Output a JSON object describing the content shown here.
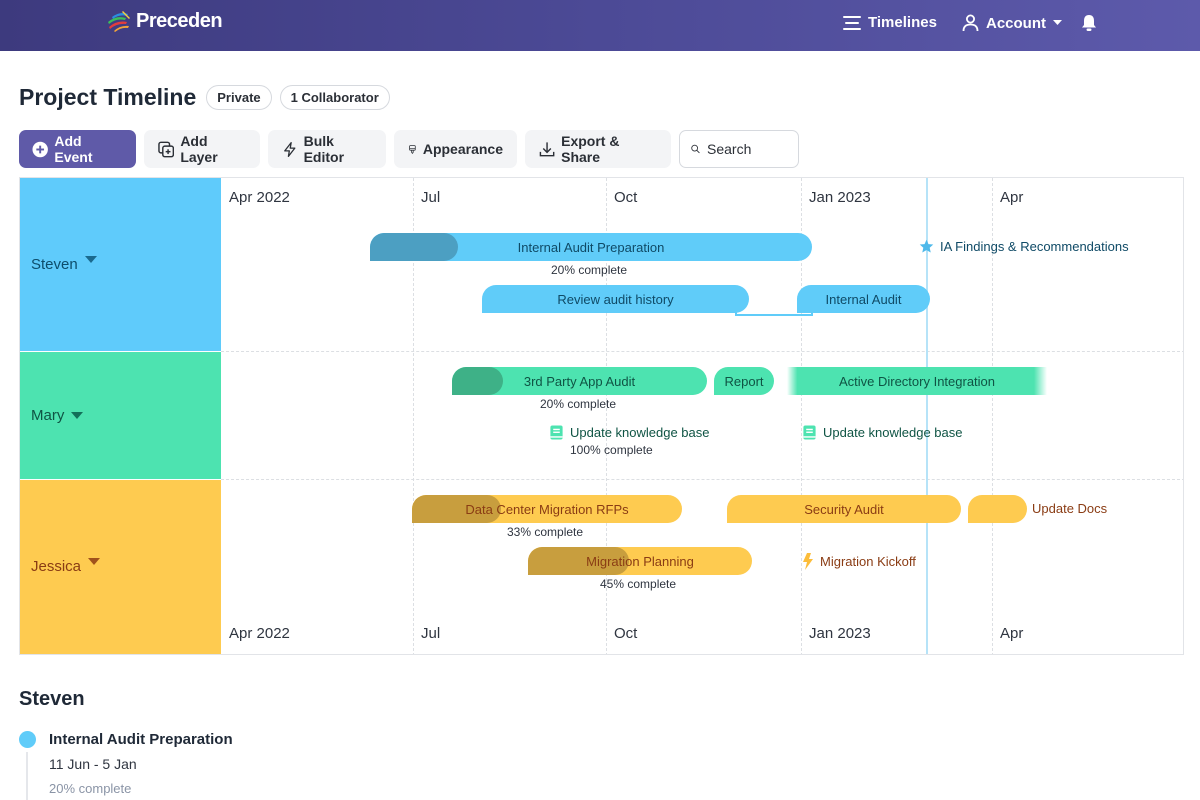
{
  "header": {
    "brand": "Preceden",
    "nav": {
      "timelines_label": "Timelines",
      "account_label": "Account"
    }
  },
  "title_row": {
    "title": "Project Timeline",
    "privacy_badge": "Private",
    "collaborators_badge": "1 Collaborator"
  },
  "toolbar": {
    "add_event": "Add Event",
    "add_layer": "Add Layer",
    "bulk_editor": "Bulk Editor",
    "appearance": "Appearance",
    "export_share": "Export & Share",
    "search_placeholder": "Search"
  },
  "timeline": {
    "axis_top": [
      "Apr 2022",
      "Jul",
      "Oct",
      "Jan 2023",
      "Apr"
    ],
    "axis_bottom": [
      "Apr 2022",
      "Jul",
      "Oct",
      "Jan 2023",
      "Apr"
    ],
    "colors": {
      "steven": "#5fcbfb",
      "mary": "#4de3b0",
      "jessica": "#fecb50",
      "header": "#4c4a96",
      "primary_button": "#5f5aa8"
    },
    "lanes": [
      {
        "name": "Steven",
        "events": [
          {
            "label": "Internal Audit Preparation",
            "progress": "20% complete",
            "progress_pct": 20
          },
          {
            "label": "Review audit history"
          },
          {
            "label": "Internal Audit"
          },
          {
            "label": "IA Findings & Recommendations",
            "icon": "star-icon"
          }
        ]
      },
      {
        "name": "Mary",
        "events": [
          {
            "label": "3rd Party App Audit",
            "progress": "20% complete",
            "progress_pct": 20
          },
          {
            "label": "Report"
          },
          {
            "label": "Active Directory Integration"
          },
          {
            "label": "Update knowledge base",
            "progress": "100% complete",
            "icon": "book-icon"
          },
          {
            "label": "Update knowledge base",
            "icon": "book-icon"
          }
        ]
      },
      {
        "name": "Jessica",
        "events": [
          {
            "label": "Data Center Migration RFPs",
            "progress": "33% complete",
            "progress_pct": 33
          },
          {
            "label": "Security Audit"
          },
          {
            "label": "Update Docs"
          },
          {
            "label": "Migration Planning",
            "progress": "45% complete",
            "progress_pct": 45
          },
          {
            "label": "Migration Kickoff",
            "icon": "lightning-icon"
          }
        ]
      }
    ]
  },
  "details": {
    "section_title": "Steven",
    "items": [
      {
        "title": "Internal Audit Preparation",
        "dates": "11 Jun - 5 Jan",
        "progress": "20% complete"
      }
    ]
  }
}
